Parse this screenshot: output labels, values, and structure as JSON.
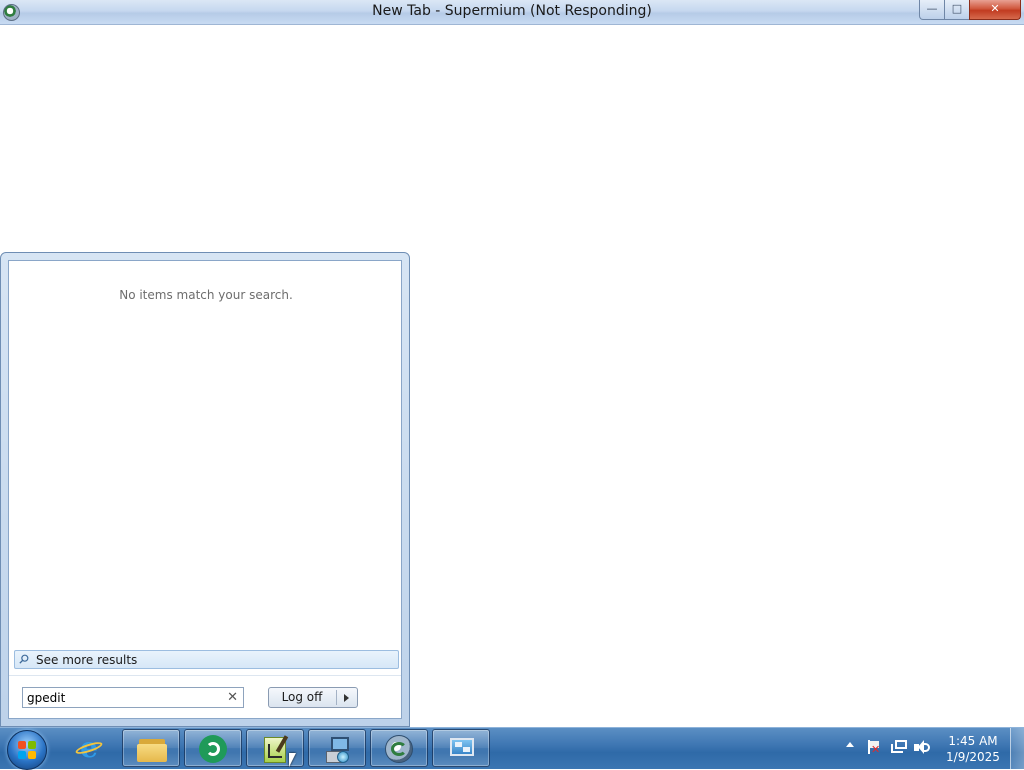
{
  "window": {
    "title": "New Tab - Supermium (Not Responding)",
    "controls": {
      "minimize": "minimize",
      "maximize": "maximize",
      "close": "✕"
    }
  },
  "start_menu": {
    "no_results_text": "No items match your search.",
    "see_more_label": "See more results",
    "search": {
      "value": "gpedit",
      "clear_glyph": "✕"
    },
    "logoff_label": "Log off"
  },
  "taskbar": {
    "items": [
      {
        "name": "start-button",
        "icon": "windows-orb-icon"
      },
      {
        "name": "internet-explorer",
        "icon": "internet-explorer-icon"
      },
      {
        "name": "windows-explorer",
        "icon": "folder-icon"
      },
      {
        "name": "green-app",
        "icon": "green-refresh-icon"
      },
      {
        "name": "notepad-plus-plus",
        "icon": "notepad-icon"
      },
      {
        "name": "network-computer",
        "icon": "computer-globe-icon"
      },
      {
        "name": "supermium",
        "icon": "supermium-icon"
      },
      {
        "name": "remote-desktop",
        "icon": "remote-desktop-icon"
      }
    ],
    "tray": {
      "time": "1:45 AM",
      "date": "1/9/2025"
    }
  },
  "colors": {
    "taskbar": "#3f77b3",
    "close_button": "#c13b20",
    "start_menu_frame": "#bdd2ea"
  }
}
